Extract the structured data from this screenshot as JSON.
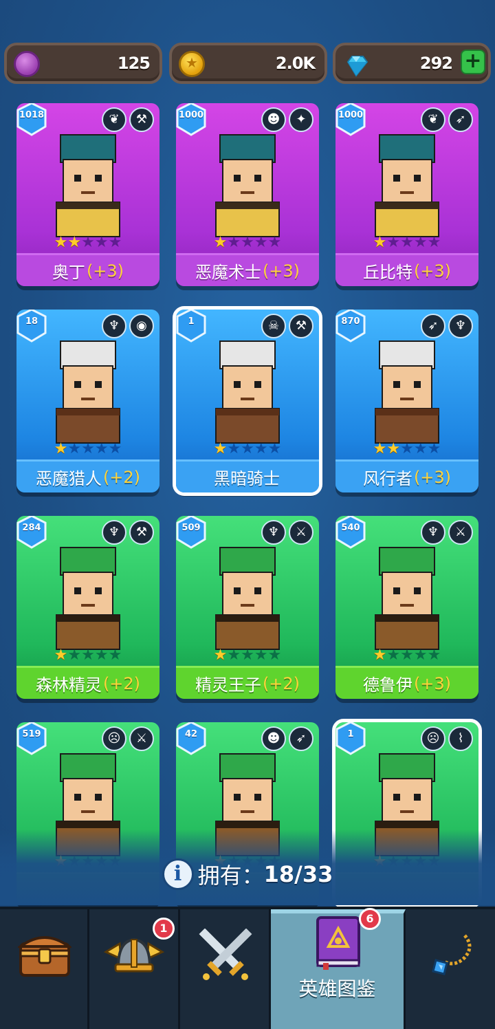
{
  "currency": {
    "purple_token": "125",
    "gold": "2.0K",
    "gems": "292",
    "plus": "+"
  },
  "heroes": [
    {
      "name": "奥丁",
      "bonus": "(+3)",
      "level": "1018",
      "stars": 2,
      "rarity": "purple",
      "badges": [
        "wings-icon",
        "hammer-icon"
      ]
    },
    {
      "name": "恶魔术士",
      "bonus": "(+3)",
      "level": "1000",
      "stars": 1,
      "rarity": "purple",
      "badges": [
        "demon-icon",
        "spell-icon"
      ]
    },
    {
      "name": "丘比特",
      "bonus": "(+3)",
      "level": "1000",
      "stars": 1,
      "rarity": "purple",
      "badges": [
        "wings-icon",
        "bow-icon"
      ]
    },
    {
      "name": "恶魔猎人",
      "bonus": "(+2)",
      "level": "18",
      "stars": 1,
      "rarity": "blue",
      "badges": [
        "elf-icon",
        "eye-icon"
      ]
    },
    {
      "name": "黑暗骑士",
      "bonus": "",
      "level": "1",
      "stars": 1,
      "rarity": "blue",
      "badges": [
        "skull-icon",
        "hammer-icon"
      ],
      "selected": true
    },
    {
      "name": "风行者",
      "bonus": "(+3)",
      "level": "870",
      "stars": 2,
      "rarity": "blue",
      "badges": [
        "bow-icon",
        "elf-icon"
      ]
    },
    {
      "name": "森林精灵",
      "bonus": "(+2)",
      "level": "284",
      "stars": 1,
      "rarity": "green",
      "badges": [
        "elf-icon",
        "hammer-icon"
      ]
    },
    {
      "name": "精灵王子",
      "bonus": "(+2)",
      "level": "509",
      "stars": 1,
      "rarity": "green",
      "badges": [
        "elf-icon",
        "sword-icon"
      ]
    },
    {
      "name": "德鲁伊",
      "bonus": "(+3)",
      "level": "540",
      "stars": 1,
      "rarity": "green",
      "badges": [
        "elf-icon",
        "sword-icon"
      ]
    },
    {
      "name": "",
      "bonus": "",
      "level": "519",
      "stars": 1,
      "rarity": "green",
      "badges": [
        "orc-icon",
        "sword-icon"
      ]
    },
    {
      "name": "",
      "bonus": "",
      "level": "42",
      "stars": 1,
      "rarity": "green",
      "badges": [
        "demon-icon",
        "bow-icon"
      ]
    },
    {
      "name": "",
      "bonus": "",
      "level": "1",
      "stars": 1,
      "rarity": "green",
      "badges": [
        "orc-icon",
        "torch-icon"
      ],
      "selected": true
    }
  ],
  "owned": {
    "label": "拥有：",
    "count": "18/33"
  },
  "nav": {
    "items": [
      {
        "name": "chest-icon",
        "badge": ""
      },
      {
        "name": "viking-helmet-icon",
        "badge": "1"
      },
      {
        "name": "crossed-swords-icon",
        "badge": ""
      },
      {
        "name": "hero-codex-icon",
        "badge": "6",
        "label": "英雄图鉴"
      },
      {
        "name": "amulet-icon",
        "badge": ""
      }
    ]
  },
  "colors": {
    "background": "#1c4f86",
    "purple_card": "#b94ae0",
    "blue_card": "#3aa2f3",
    "green_card": "#5fd42e",
    "bonus_text": "#ffd33a"
  }
}
